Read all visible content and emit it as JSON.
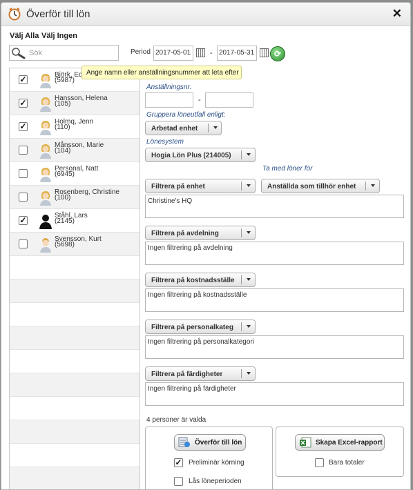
{
  "window": {
    "title": "Överför till lön"
  },
  "selection": {
    "select_all": "Välj Alla",
    "select_none": "Välj Ingen"
  },
  "search": {
    "placeholder": "Sök",
    "value": ""
  },
  "period": {
    "label": "Period",
    "from": "2017-05-01",
    "separator": "-",
    "to": "2017-05-31"
  },
  "tooltip": "Ange namn eller anställningsnummer att leta efter",
  "employees": [
    {
      "name": "Björk, Edo",
      "number": "(5987)",
      "checked": true,
      "avatar": "female"
    },
    {
      "name": "Hansson, Helena",
      "number": "(105)",
      "checked": true,
      "avatar": "female"
    },
    {
      "name": "Holmq, Jenn",
      "number": "(110)",
      "checked": true,
      "avatar": "female"
    },
    {
      "name": "Månsson, Marie",
      "number": "(104)",
      "checked": false,
      "avatar": "female"
    },
    {
      "name": "Personal, Natt",
      "number": "(6945)",
      "checked": false,
      "avatar": "female"
    },
    {
      "name": "Rosenberg, Christine",
      "number": "(100)",
      "checked": false,
      "avatar": "female"
    },
    {
      "name": "Ståhl, Lars",
      "number": "(2145)",
      "checked": true,
      "avatar": "silhouette"
    },
    {
      "name": "Svensson, Kurt",
      "number": "(5698)",
      "checked": false,
      "avatar": "male"
    }
  ],
  "form": {
    "employment_nr_label": "Anställningsnr.",
    "employment_nr_from": "",
    "employment_nr_separator": "-",
    "employment_nr_to": "",
    "group_label": "Gruppera löneutfall enligt:",
    "group_value": "Arbetad enhet",
    "payroll_system_label": "Lönesystem",
    "payroll_system_value": "Hogia Lön Plus (214005)",
    "include_salaries_label": "Ta med löner för",
    "filter_unit_label": "Filtrera på enhet",
    "include_salaries_value": "Anställda som tillhör enhet",
    "filter_unit_text": "Christine's HQ",
    "filter_department_label": "Filtrera på avdelning",
    "filter_department_text": "Ingen filtrering på avdelning",
    "filter_costcenter_label": "Filtrera på kostnadsställe",
    "filter_costcenter_text": "Ingen filtrering på kostnadsställe",
    "filter_category_label": "Filtrera på personalkateg",
    "filter_category_text": "Ingen filtrering på personalkategori",
    "filter_skills_label": "Filtrera på färdigheter",
    "filter_skills_text": "Ingen filtrering på färdigheter"
  },
  "status_text": "4 personer är valda",
  "transfer_panel": {
    "button": "Överför till lön",
    "preliminary_label": "Preliminär körning",
    "preliminary_checked": true,
    "lock_label": "Lås löneperioden",
    "lock_checked": false
  },
  "excel_panel": {
    "button": "Skapa Excel-rapport",
    "totals_label": "Bara totaler",
    "totals_checked": false
  },
  "colors": {
    "label_blue": "#2a4f86",
    "tooltip_bg": "#fffdc4",
    "refresh_green": "#2f8f2f"
  }
}
